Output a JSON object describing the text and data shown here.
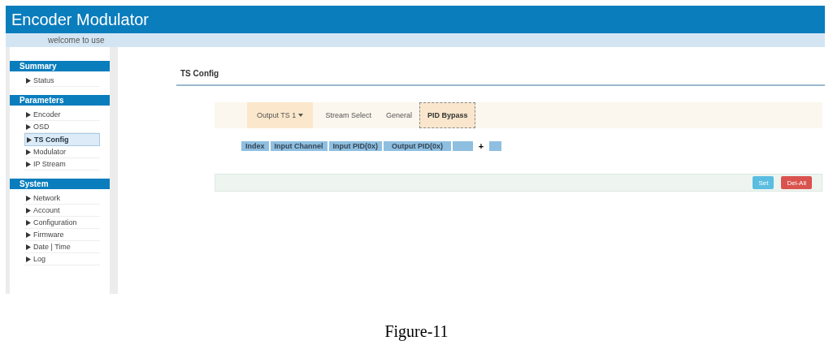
{
  "header": {
    "title": "Encoder Modulator",
    "welcome": "welcome to use"
  },
  "sidebar": [
    {
      "heading": "Summary",
      "items": [
        {
          "label": "Status",
          "selected": false
        }
      ]
    },
    {
      "heading": "Parameters",
      "items": [
        {
          "label": "Encoder",
          "selected": false
        },
        {
          "label": "OSD",
          "selected": false
        },
        {
          "label": "TS Config",
          "selected": true
        },
        {
          "label": "Modulator",
          "selected": false
        },
        {
          "label": "IP Stream",
          "selected": false
        }
      ]
    },
    {
      "heading": "System",
      "items": [
        {
          "label": "Network",
          "selected": false
        },
        {
          "label": "Account",
          "selected": false
        },
        {
          "label": "Configuration",
          "selected": false
        },
        {
          "label": "Firmware",
          "selected": false
        },
        {
          "label": "Date | Time",
          "selected": false
        },
        {
          "label": "Log",
          "selected": false
        }
      ]
    }
  ],
  "page_title": "TS Config",
  "tabs": [
    {
      "label": "Output TS 1",
      "kind": "dropdown",
      "selected": false
    },
    {
      "label": "Stream Select",
      "kind": "tab",
      "selected": false
    },
    {
      "label": "General",
      "kind": "tab",
      "selected": false
    },
    {
      "label": "PID Bypass",
      "kind": "tab",
      "selected": true
    }
  ],
  "table": {
    "columns": [
      "Index",
      "Input Channel",
      "Input PID(0x)",
      "Output PID(0x)"
    ],
    "add_button": "+"
  },
  "buttons": [
    {
      "label": "Set",
      "kind": "info"
    },
    {
      "label": "Del-All",
      "kind": "danger"
    }
  ],
  "caption": "Figure-11"
}
